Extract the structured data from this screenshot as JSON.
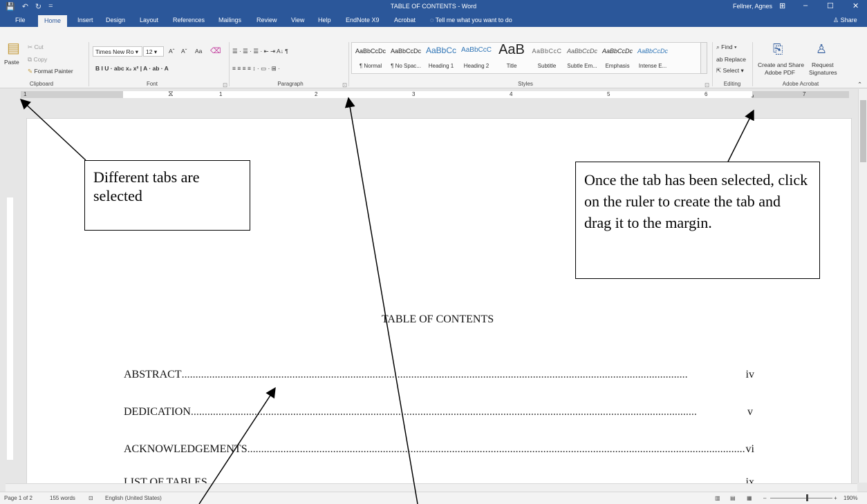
{
  "window": {
    "title": "TABLE OF CONTENTS  -  Word",
    "user": "Fellner, Agnes",
    "qat": [
      "💾",
      "↶",
      "↻",
      "="
    ],
    "controls": [
      "⊞",
      "–",
      "☐",
      "✕"
    ]
  },
  "tabs": [
    "File",
    "Home",
    "Insert",
    "Design",
    "Layout",
    "References",
    "Mailings",
    "Review",
    "View",
    "Help",
    "EndNote X9",
    "Acrobat"
  ],
  "tell_me": "Tell me what you want to do",
  "share": "Share",
  "ribbon": {
    "clipboard": {
      "paste": "Paste",
      "cut": "Cut",
      "copy": "Copy",
      "format_painter": "Format Painter",
      "label": "Clipboard"
    },
    "font": {
      "name": "Times New Ro",
      "size": "12",
      "grow": "Aˆ",
      "shrink": "Aˇ",
      "case": "Aa",
      "format_row": "B  I  U  ·  abc  x₂  x²  |  A  ·  ab  ·  A",
      "label": "Font"
    },
    "paragraph": {
      "row1": "☰ · ☰ · ☰ ·   ⇤  ⇥   A↓  ¶",
      "row2": "≡  ≡  ≡  ≡   ↕ ·   ▭ · ⊞ ·",
      "label": "Paragraph"
    },
    "styles": {
      "label": "Styles",
      "items": [
        {
          "preview": "AaBbCcDc",
          "name": "¶ Normal"
        },
        {
          "preview": "AaBbCcDc",
          "name": "¶ No Spac..."
        },
        {
          "preview": "AaBbCc",
          "name": "Heading 1"
        },
        {
          "preview": "AaBbCcC",
          "name": "Heading 2"
        },
        {
          "preview": "AaB",
          "name": "Title"
        },
        {
          "preview": "AaBbCcC",
          "name": "Subtitle"
        },
        {
          "preview": "AaBbCcDc",
          "name": "Subtle Em..."
        },
        {
          "preview": "AaBbCcDc",
          "name": "Emphasis"
        },
        {
          "preview": "AaBbCcDc",
          "name": "Intense E..."
        }
      ]
    },
    "editing": {
      "find": "Find",
      "replace": "Replace",
      "select": "Select",
      "label": "Editing"
    },
    "acrobat": {
      "create": "Create and Share",
      "create2": "Adobe PDF",
      "request": "Request",
      "request2": "Signatures",
      "label": "Adobe Acrobat"
    }
  },
  "ruler": {
    "numbers": [
      "1",
      "1",
      "2",
      "3",
      "4",
      "5",
      "6",
      "7"
    ]
  },
  "document": {
    "heading": "TABLE OF CONTENTS",
    "entries": [
      {
        "text": "ABSTRACT",
        "page": "iv"
      },
      {
        "text": "DEDICATION",
        "page": "v"
      },
      {
        "text": "ACKNOWLEDGEMENTS",
        "page": "vi"
      },
      {
        "text": "LIST OF TABLES",
        "page": "ix"
      }
    ],
    "leader": "......................................................................................................................................................................................."
  },
  "status": {
    "page": "Page 1 of 2",
    "words": "155 words",
    "lang": "English (United States)",
    "zoom": "190%"
  },
  "callouts": {
    "tabs_note": "Different tabs are selected",
    "ruler_note": "Once the tab has been selected, click on the ruler to create the tab and drag it to the margin."
  }
}
